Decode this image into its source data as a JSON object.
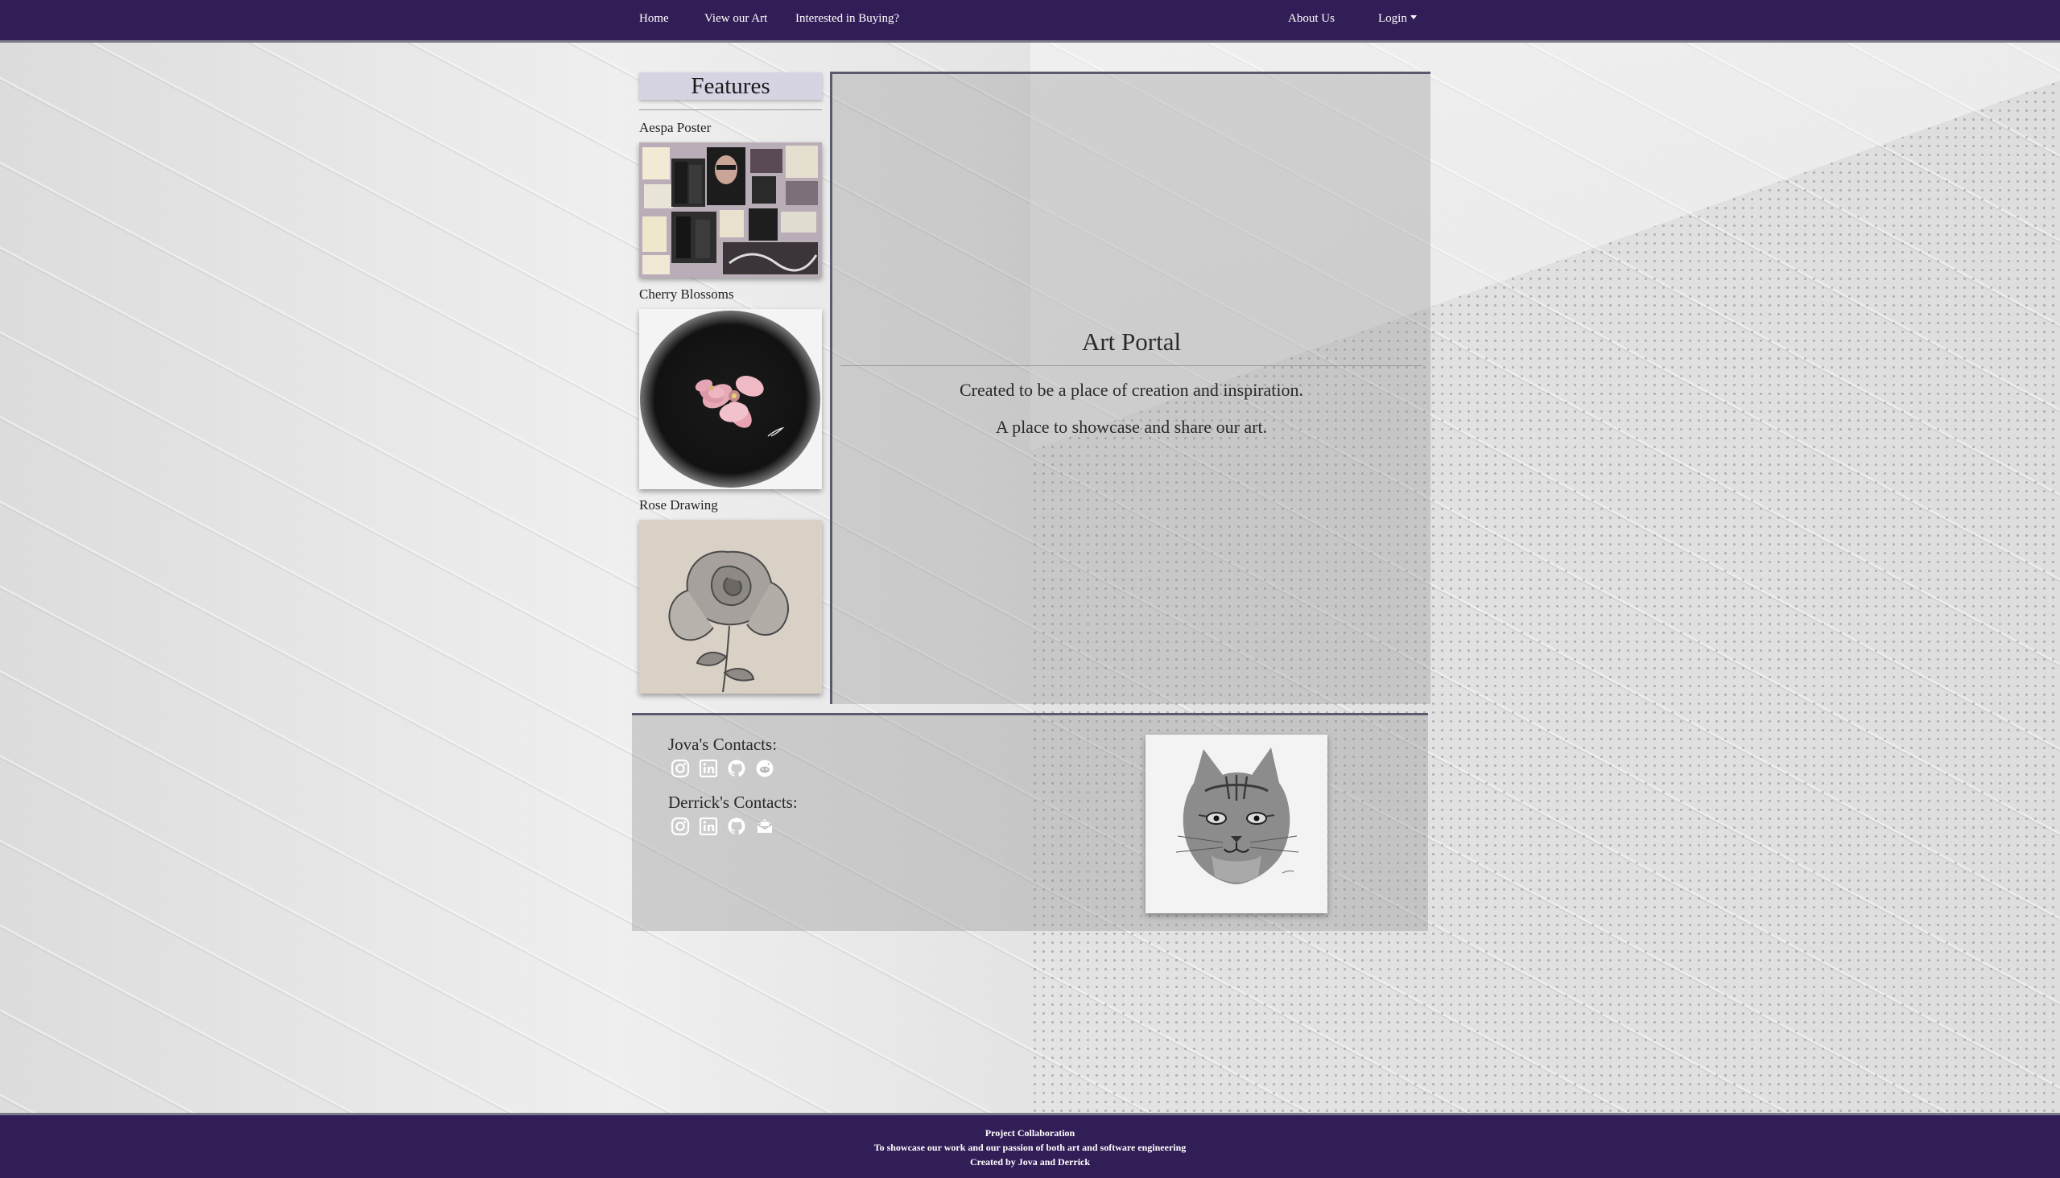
{
  "nav": {
    "home": "Home",
    "view_art": "View our Art",
    "buying": "Interested in Buying?",
    "about": "About Us",
    "login": "Login"
  },
  "features": {
    "title": "Features",
    "items": [
      {
        "label": "Aespa Poster"
      },
      {
        "label": "Cherry Blossoms"
      },
      {
        "label": "Rose Drawing"
      }
    ]
  },
  "portal": {
    "title": "Art Portal",
    "line1": "Created to be a place of creation and inspiration.",
    "line2": "A place to showcase and share our art."
  },
  "contacts": {
    "jova_heading": "Jova's Contacts:",
    "jova_icons": [
      "instagram-icon",
      "linkedin-icon",
      "github-icon",
      "reddit-icon"
    ],
    "derrick_heading": "Derrick's Contacts:",
    "derrick_icons": [
      "instagram-icon",
      "linkedin-icon",
      "github-icon",
      "mail-icon"
    ]
  },
  "footer": {
    "line1": "Project Collaboration",
    "line2": "To showcase our work and our passion of both art and software engineering",
    "line3": "Created by Jova and Derrick"
  },
  "colors": {
    "nav_bg": "#321e57",
    "features_header_bg": "#d6d3e2",
    "panel_border": "#5a5a6e"
  }
}
